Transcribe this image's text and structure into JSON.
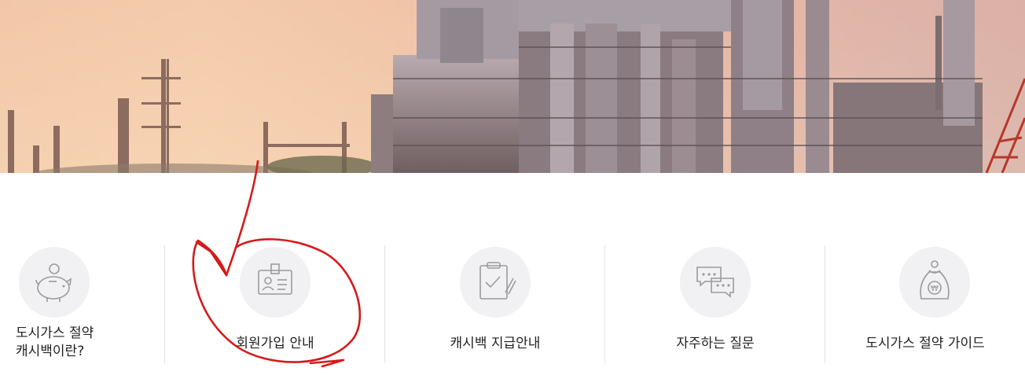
{
  "hero": {
    "image_name": "industrial-plant-at-dusk"
  },
  "menu": {
    "items": [
      {
        "label_line1": "도시가스 절약",
        "label_line2": "캐시백이란?",
        "icon": "piggy-bank-icon"
      },
      {
        "label": "회원가입 안내",
        "icon": "member-card-icon"
      },
      {
        "label": "캐시백 지급안내",
        "icon": "clipboard-check-icon"
      },
      {
        "label": "자주하는 질문",
        "icon": "chat-bubbles-icon"
      },
      {
        "label": "도시가스 절약 가이드",
        "icon": "money-bag-icon"
      }
    ]
  },
  "colors": {
    "icon_bg": "#f1f1f3",
    "icon_stroke": "#9a9aa0",
    "divider": "#e3e3e3",
    "annotation": "#d41a1a"
  }
}
